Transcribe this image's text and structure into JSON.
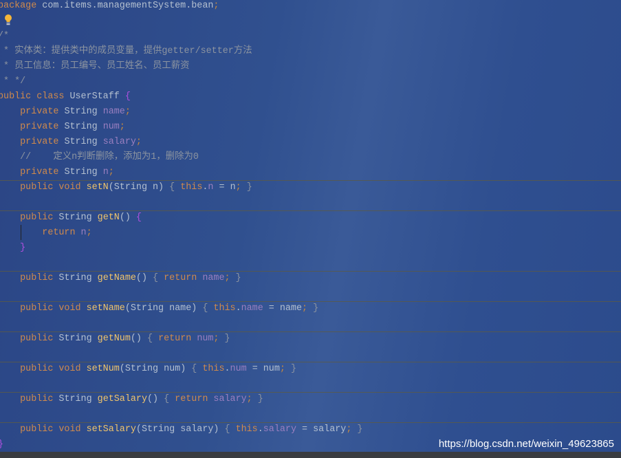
{
  "editor": {
    "language": "java",
    "colors": {
      "background": "#2d4b8c",
      "keyword": "#d08a4c",
      "default": "#b4c0d0",
      "field": "#9a7fc0",
      "method": "#f0c46a",
      "comment": "#8c94a0",
      "brace": "#b050e0"
    },
    "lines": [
      {
        "tokens": [
          [
            "package",
            "kw"
          ],
          [
            " com.items.managementSystem.bean",
            "def"
          ],
          [
            ";",
            "punc"
          ]
        ]
      },
      {
        "tokens": [],
        "icon": "lightbulb-icon"
      },
      {
        "tokens": [
          [
            "/*",
            "comment"
          ]
        ]
      },
      {
        "tokens": [
          [
            " * 实体类：提供类中的成员变量，提供getter/setter方法",
            "comment"
          ]
        ]
      },
      {
        "tokens": [
          [
            " * 员工信息：员工编号、员工姓名、员工薪资",
            "comment"
          ]
        ]
      },
      {
        "tokens": [
          [
            " * */",
            "comment"
          ]
        ]
      },
      {
        "tokens": [
          [
            "public class ",
            "kw"
          ],
          [
            "UserStaff ",
            "def"
          ],
          [
            "{",
            "brace"
          ]
        ]
      },
      {
        "tokens": [
          [
            "    private ",
            "kw"
          ],
          [
            "String ",
            "def"
          ],
          [
            "name",
            "field"
          ],
          [
            ";",
            "punc"
          ]
        ]
      },
      {
        "tokens": [
          [
            "    private ",
            "kw"
          ],
          [
            "String ",
            "def"
          ],
          [
            "num",
            "field"
          ],
          [
            ";",
            "punc"
          ]
        ]
      },
      {
        "tokens": [
          [
            "    private ",
            "kw"
          ],
          [
            "String ",
            "def"
          ],
          [
            "salary",
            "field"
          ],
          [
            ";",
            "punc"
          ]
        ]
      },
      {
        "tokens": [
          [
            "    //    定义n判断删除，添加为1，删除为0",
            "comment"
          ]
        ]
      },
      {
        "tokens": [
          [
            "    private ",
            "kw"
          ],
          [
            "String ",
            "def"
          ],
          [
            "n",
            "field"
          ],
          [
            ";",
            "punc"
          ]
        ]
      },
      {
        "sep": true,
        "tokens": [
          [
            "    public void ",
            "kw"
          ],
          [
            "setN",
            "method"
          ],
          [
            "(String n) ",
            "def"
          ],
          [
            "{ ",
            "comment"
          ],
          [
            "this",
            "kw"
          ],
          [
            ".",
            "def"
          ],
          [
            "n",
            "field"
          ],
          [
            " = n",
            "def"
          ],
          [
            ";",
            "punc"
          ],
          [
            " }",
            "comment"
          ]
        ]
      },
      {
        "tokens": []
      },
      {
        "sep": true,
        "tokens": [
          [
            "    public ",
            "kw"
          ],
          [
            "String ",
            "def"
          ],
          [
            "getN",
            "method"
          ],
          [
            "() ",
            "def"
          ],
          [
            "{",
            "brace"
          ]
        ]
      },
      {
        "tokens": [
          [
            "        return ",
            "kw"
          ],
          [
            "n",
            "field"
          ],
          [
            ";",
            "punc"
          ]
        ]
      },
      {
        "tokens": [
          [
            "    }",
            "brace"
          ]
        ]
      },
      {
        "tokens": []
      },
      {
        "sep": true,
        "tokens": [
          [
            "    public ",
            "kw"
          ],
          [
            "String ",
            "def"
          ],
          [
            "getName",
            "method"
          ],
          [
            "() ",
            "def"
          ],
          [
            "{ ",
            "comment"
          ],
          [
            "return ",
            "kw"
          ],
          [
            "name",
            "field"
          ],
          [
            ";",
            "punc"
          ],
          [
            " }",
            "comment"
          ]
        ]
      },
      {
        "tokens": []
      },
      {
        "sep": true,
        "tokens": [
          [
            "    public void ",
            "kw"
          ],
          [
            "setName",
            "method"
          ],
          [
            "(String name) ",
            "def"
          ],
          [
            "{ ",
            "comment"
          ],
          [
            "this",
            "kw"
          ],
          [
            ".",
            "def"
          ],
          [
            "name",
            "field"
          ],
          [
            " = name",
            "def"
          ],
          [
            ";",
            "punc"
          ],
          [
            " }",
            "comment"
          ]
        ]
      },
      {
        "tokens": []
      },
      {
        "sep": true,
        "tokens": [
          [
            "    public ",
            "kw"
          ],
          [
            "String ",
            "def"
          ],
          [
            "getNum",
            "method"
          ],
          [
            "() ",
            "def"
          ],
          [
            "{ ",
            "comment"
          ],
          [
            "return ",
            "kw"
          ],
          [
            "num",
            "field"
          ],
          [
            ";",
            "punc"
          ],
          [
            " }",
            "comment"
          ]
        ]
      },
      {
        "tokens": []
      },
      {
        "sep": true,
        "tokens": [
          [
            "    public void ",
            "kw"
          ],
          [
            "setNum",
            "method"
          ],
          [
            "(String num) ",
            "def"
          ],
          [
            "{ ",
            "comment"
          ],
          [
            "this",
            "kw"
          ],
          [
            ".",
            "def"
          ],
          [
            "num",
            "field"
          ],
          [
            " = num",
            "def"
          ],
          [
            ";",
            "punc"
          ],
          [
            " }",
            "comment"
          ]
        ]
      },
      {
        "tokens": []
      },
      {
        "sep": true,
        "tokens": [
          [
            "    public ",
            "kw"
          ],
          [
            "String ",
            "def"
          ],
          [
            "getSalary",
            "method"
          ],
          [
            "() ",
            "def"
          ],
          [
            "{ ",
            "comment"
          ],
          [
            "return ",
            "kw"
          ],
          [
            "salary",
            "field"
          ],
          [
            ";",
            "punc"
          ],
          [
            " }",
            "comment"
          ]
        ]
      },
      {
        "tokens": []
      },
      {
        "sep": true,
        "tokens": [
          [
            "    public void ",
            "kw"
          ],
          [
            "setSalary",
            "method"
          ],
          [
            "(String salary) ",
            "def"
          ],
          [
            "{ ",
            "comment"
          ],
          [
            "this",
            "kw"
          ],
          [
            ".",
            "def"
          ],
          [
            "salary",
            "field"
          ],
          [
            " = salary",
            "def"
          ],
          [
            ";",
            "punc"
          ],
          [
            " }",
            "comment"
          ]
        ]
      },
      {
        "tokens": [
          [
            "}",
            "brace"
          ]
        ]
      }
    ]
  },
  "watermark": "https://blog.csdn.net/weixin_49623865"
}
